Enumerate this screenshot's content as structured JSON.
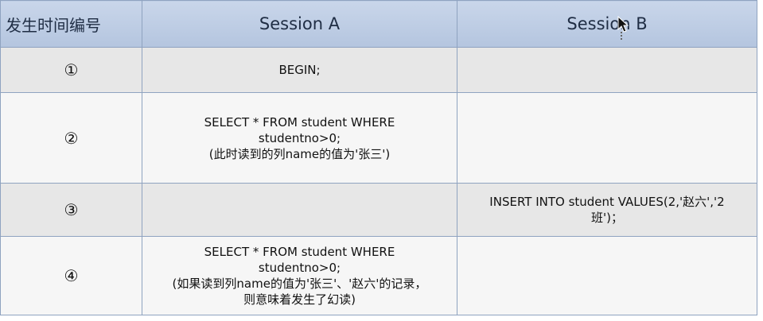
{
  "table": {
    "headers": [
      "发生时间编号",
      "Session A",
      "Session B"
    ],
    "rows": [
      {
        "id": "①",
        "session_a": [
          "BEGIN;"
        ],
        "session_b": []
      },
      {
        "id": "②",
        "session_a": [
          "SELECT * FROM student WHERE",
          "studentno>0;",
          "(此时读到的列name的值为'张三')"
        ],
        "session_b": []
      },
      {
        "id": "③",
        "session_a": [],
        "session_b": [
          "INSERT INTO student VALUES(2,'赵六','2",
          "班')；"
        ]
      },
      {
        "id": "④",
        "session_a": [
          "SELECT * FROM student WHERE",
          "studentno>0;",
          "(如果读到列name的值为'张三'、'赵六'的记录，",
          "则意味着发生了幻读)"
        ],
        "session_b": []
      }
    ]
  },
  "cursor": {
    "icon": "mouse-pointer-icon"
  }
}
